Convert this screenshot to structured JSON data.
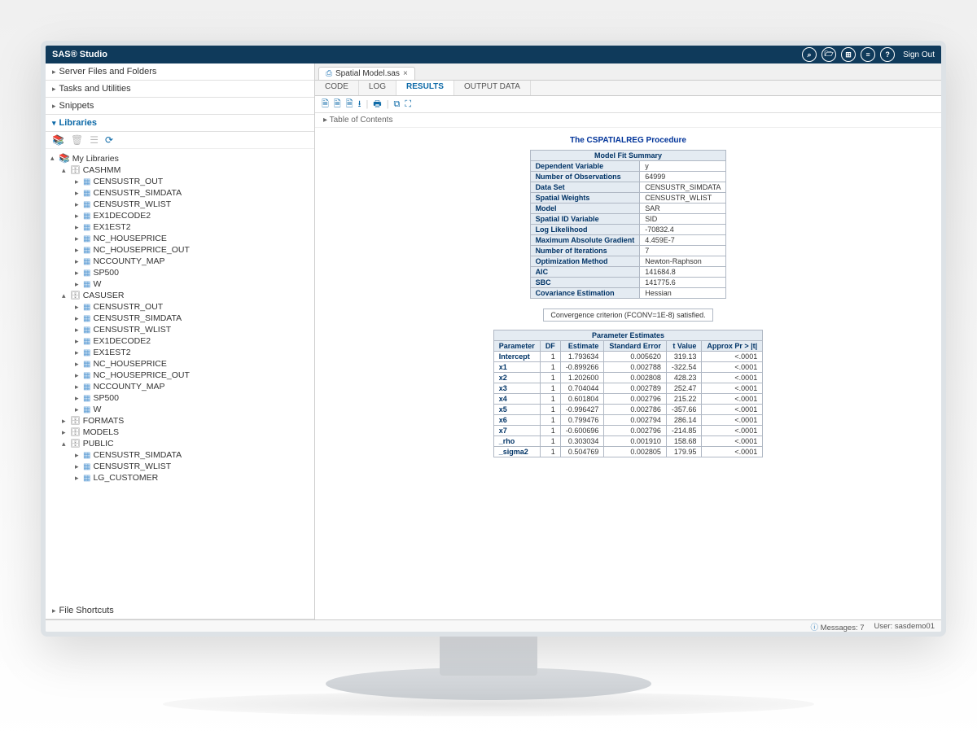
{
  "header": {
    "title": "SAS® Studio",
    "signout": "Sign Out"
  },
  "sidebar": {
    "sections": [
      "Server Files and Folders",
      "Tasks and Utilities",
      "Snippets",
      "Libraries",
      "File Shortcuts"
    ],
    "active": "Libraries",
    "libraries_root": "My Libraries",
    "libs": [
      {
        "name": "CASHMM",
        "open": true,
        "items": [
          "CENSUSTR_OUT",
          "CENSUSTR_SIMDATA",
          "CENSUSTR_WLIST",
          "EX1DECODE2",
          "EX1EST2",
          "NC_HOUSEPRICE",
          "NC_HOUSEPRICE_OUT",
          "NCCOUNTY_MAP",
          "SP500",
          "W"
        ]
      },
      {
        "name": "CASUSER",
        "open": true,
        "items": [
          "CENSUSTR_OUT",
          "CENSUSTR_SIMDATA",
          "CENSUSTR_WLIST",
          "EX1DECODE2",
          "EX1EST2",
          "NC_HOUSEPRICE",
          "NC_HOUSEPRICE_OUT",
          "NCCOUNTY_MAP",
          "SP500",
          "W"
        ]
      },
      {
        "name": "FORMATS",
        "open": false
      },
      {
        "name": "MODELS",
        "open": false
      },
      {
        "name": "PUBLIC",
        "open": true,
        "items": [
          "CENSUSTR_SIMDATA",
          "CENSUSTR_WLIST",
          "LG_CUSTOMER"
        ]
      }
    ]
  },
  "tabs": {
    "file": "Spatial Model.sas"
  },
  "subtabs": [
    "CODE",
    "LOG",
    "RESULTS",
    "OUTPUT DATA"
  ],
  "toc": "Table of Contents",
  "results": {
    "proc_title": "The CSPATIALREG Procedure",
    "fit_caption": "Model Fit Summary",
    "fit_rows": [
      [
        "Dependent Variable",
        "y"
      ],
      [
        "Number of Observations",
        "64999"
      ],
      [
        "Data Set",
        "CENSUSTR_SIMDATA"
      ],
      [
        "Spatial Weights",
        "CENSUSTR_WLIST"
      ],
      [
        "Model",
        "SAR"
      ],
      [
        "Spatial ID Variable",
        "SID"
      ],
      [
        "Log Likelihood",
        "-70832.4"
      ],
      [
        "Maximum Absolute Gradient",
        "4.459E-7"
      ],
      [
        "Number of Iterations",
        "7"
      ],
      [
        "Optimization Method",
        "Newton-Raphson"
      ],
      [
        "AIC",
        "141684.8"
      ],
      [
        "SBC",
        "141775.6"
      ],
      [
        "Covariance Estimation",
        "Hessian"
      ]
    ],
    "convergence": "Convergence criterion (FCONV=1E-8) satisfied.",
    "est_caption": "Parameter Estimates",
    "est_headers": [
      "Parameter",
      "DF",
      "Estimate",
      "Standard Error",
      "t Value",
      "Approx Pr > |t|"
    ],
    "est_rows": [
      [
        "Intercept",
        "1",
        "1.793634",
        "0.005620",
        "319.13",
        "<.0001"
      ],
      [
        "x1",
        "1",
        "-0.899266",
        "0.002788",
        "-322.54",
        "<.0001"
      ],
      [
        "x2",
        "1",
        "1.202600",
        "0.002808",
        "428.23",
        "<.0001"
      ],
      [
        "x3",
        "1",
        "0.704044",
        "0.002789",
        "252.47",
        "<.0001"
      ],
      [
        "x4",
        "1",
        "0.601804",
        "0.002796",
        "215.22",
        "<.0001"
      ],
      [
        "x5",
        "1",
        "-0.996427",
        "0.002786",
        "-357.66",
        "<.0001"
      ],
      [
        "x6",
        "1",
        "0.799476",
        "0.002794",
        "286.14",
        "<.0001"
      ],
      [
        "x7",
        "1",
        "-0.600696",
        "0.002796",
        "-214.85",
        "<.0001"
      ],
      [
        "_rho",
        "1",
        "0.303034",
        "0.001910",
        "158.68",
        "<.0001"
      ],
      [
        "_sigma2",
        "1",
        "0.504769",
        "0.002805",
        "179.95",
        "<.0001"
      ]
    ]
  },
  "status": {
    "messages": "Messages: 7",
    "user": "User: sasdemo01"
  }
}
